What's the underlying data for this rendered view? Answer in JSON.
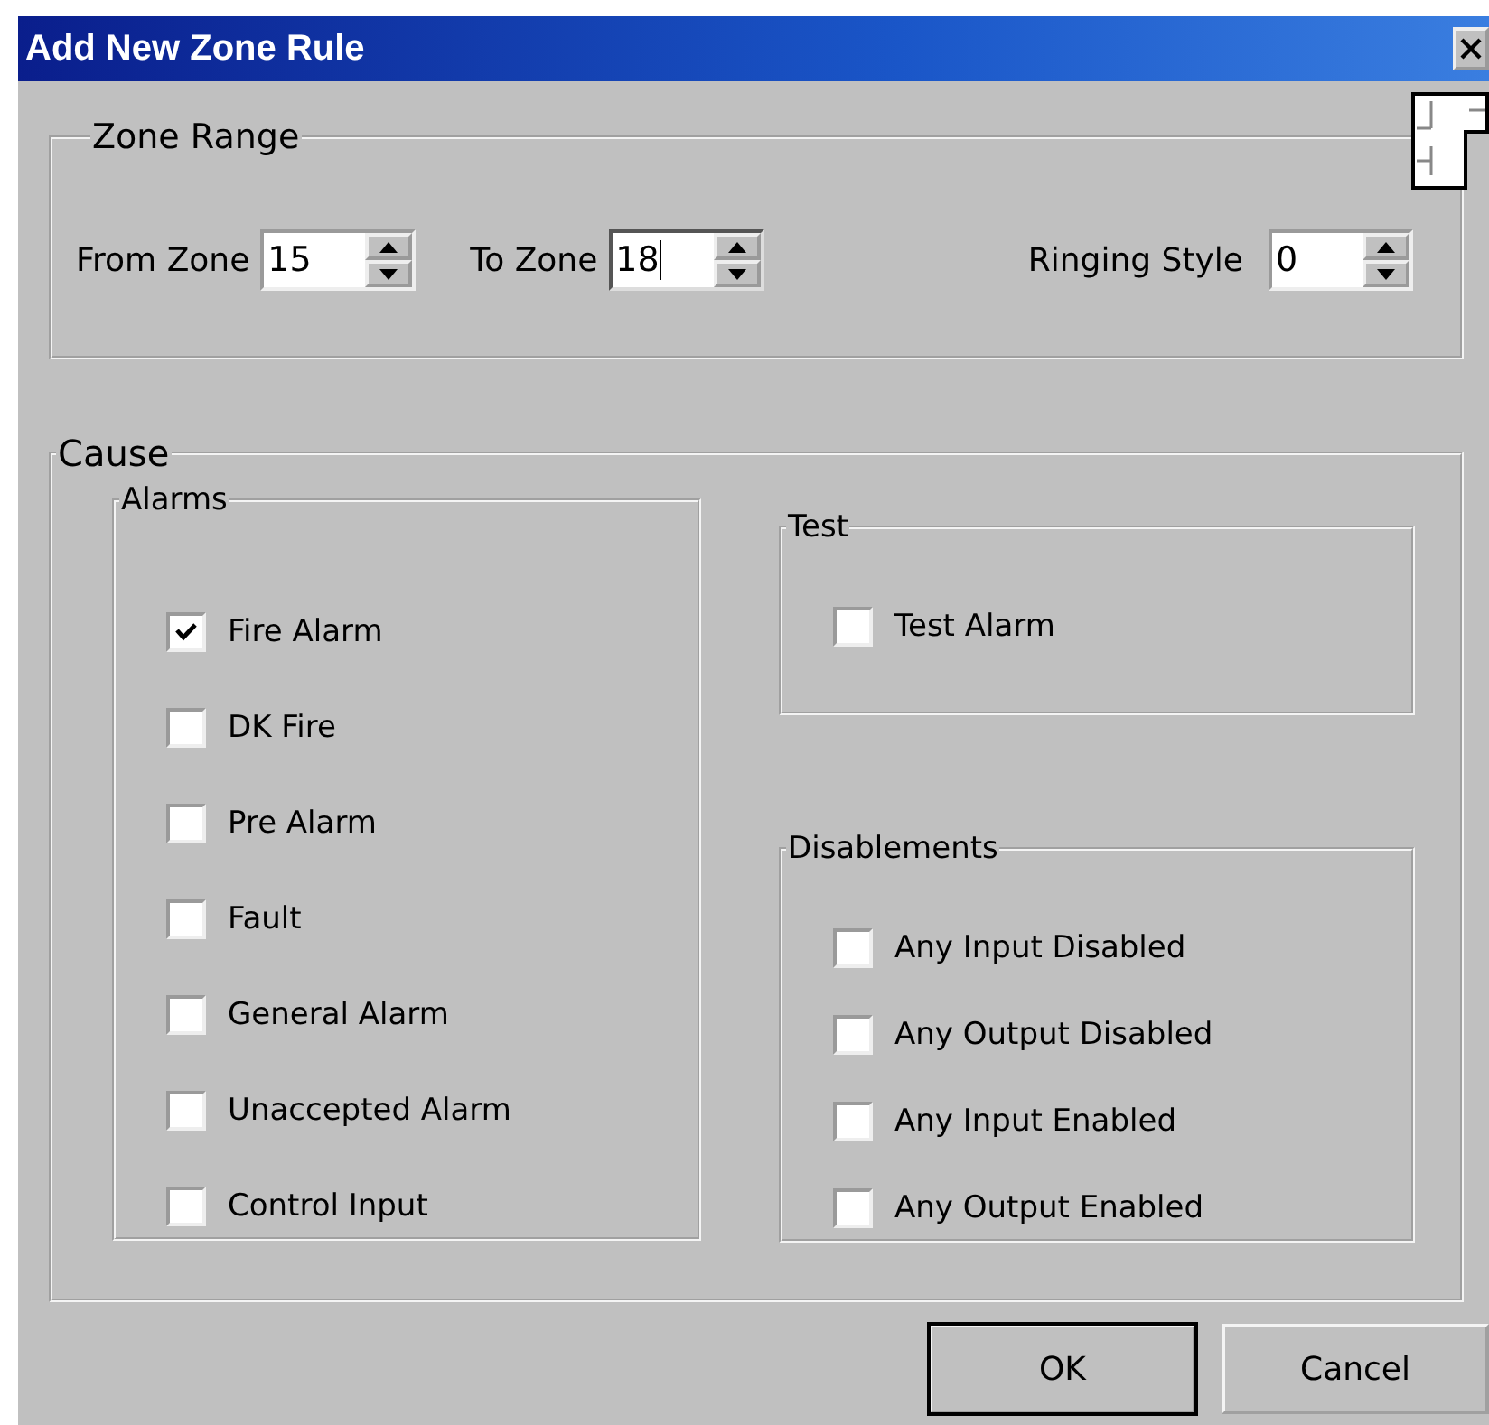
{
  "window": {
    "title": "Add New Zone Rule"
  },
  "zone_range": {
    "label": "Zone Range",
    "fields": [
      {
        "label": "From Zone",
        "value": "15",
        "focused": false
      },
      {
        "label": "To Zone",
        "value": "18",
        "focused": true
      },
      {
        "label": "Ringing Style",
        "value": "0",
        "focused": false
      }
    ]
  },
  "cause": {
    "label": "Cause",
    "alarms": {
      "label": "Alarms",
      "items": [
        {
          "label": "Fire Alarm",
          "checked": true
        },
        {
          "label": "DK Fire",
          "checked": false
        },
        {
          "label": "Pre Alarm",
          "checked": false
        },
        {
          "label": "Fault",
          "checked": false
        },
        {
          "label": "General Alarm",
          "checked": false
        },
        {
          "label": "Unaccepted Alarm",
          "checked": false
        },
        {
          "label": "Control Input",
          "checked": false
        }
      ]
    },
    "test": {
      "label": "Test",
      "items": [
        {
          "label": "Test Alarm",
          "checked": false
        }
      ]
    },
    "disablements": {
      "label": "Disablements",
      "items": [
        {
          "label": "Any Input Disabled",
          "checked": false
        },
        {
          "label": "Any Output Disabled",
          "checked": false
        },
        {
          "label": "Any Input Enabled",
          "checked": false
        },
        {
          "label": "Any Output Enabled",
          "checked": false
        }
      ]
    }
  },
  "buttons": [
    {
      "label": "OK",
      "default": true
    },
    {
      "label": "Cancel",
      "default": false
    }
  ]
}
